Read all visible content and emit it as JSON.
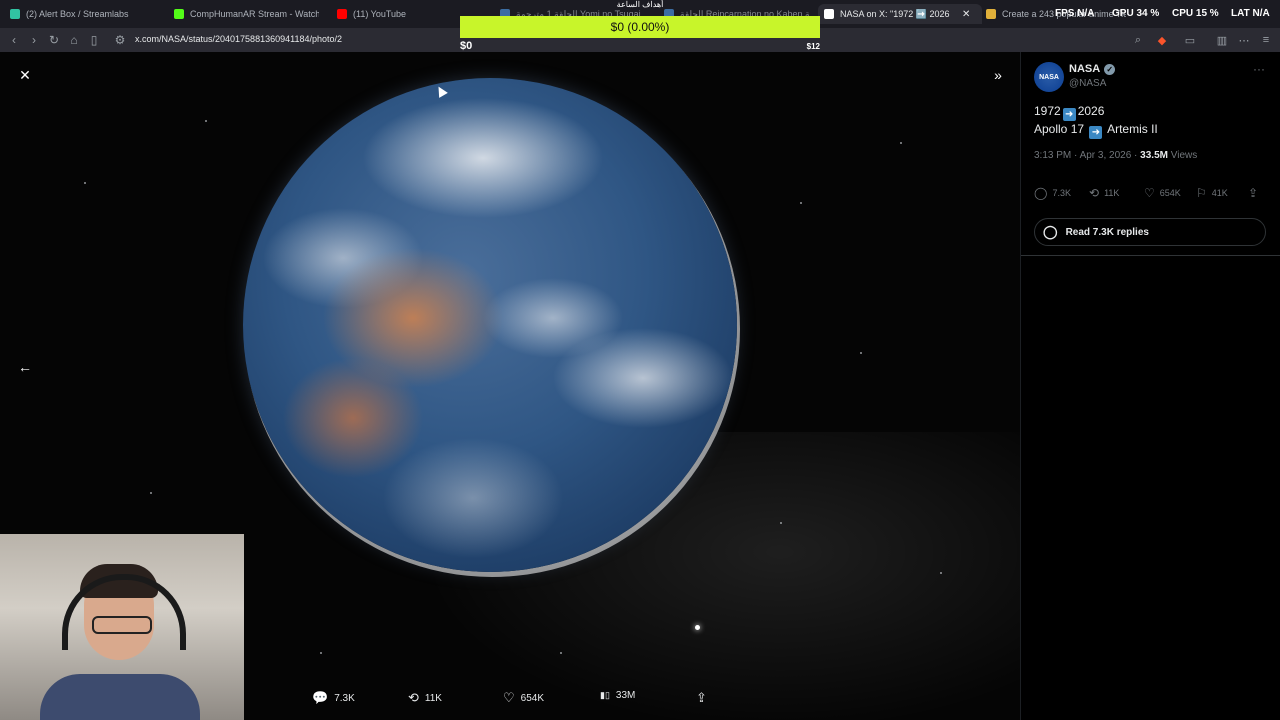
{
  "browser": {
    "tabs": [
      {
        "title": "(2) Alert Box / Streamlabs",
        "fav_color": "#31c3a2"
      },
      {
        "title": "CompHumanAR Stream - Watch Live",
        "fav_color": "#53fc18"
      },
      {
        "title": "(11) YouTube",
        "fav_color": "#ff0000"
      },
      {
        "title": "الحلقة 1 مترجمة Yomi no Tsugai",
        "fav_color": "#4a90d9"
      },
      {
        "title": "الحلقة Reincarnation no Kaben مترجمة",
        "fav_color": "#4a90d9"
      },
      {
        "title": "NASA on X: \"1972 ➡️ 2026 Apollo...",
        "fav_color": "#ffffff",
        "close": "✕"
      },
      {
        "title": "Create a 243 popular anime Tier List",
        "fav_color": "#e0b03a"
      }
    ],
    "url": "x.com/NASA/status/2040175881360941184/photo/2"
  },
  "hud": {
    "fps_label": "FPS",
    "fps_value": "N/A",
    "gpu_label": "GPU",
    "gpu_value": "34 %",
    "cpu_label": "CPU",
    "cpu_value": "15 %",
    "lat_label": "LAT",
    "lat_value": "N/A"
  },
  "goal": {
    "title": "أهداف الساعة",
    "progress_text": "$0 (0.00%)",
    "progress": 0.0,
    "min_label": "$0",
    "max_label": "$12",
    "bar_color": "#c8f52a"
  },
  "viewer": {
    "actions": [
      {
        "icon": "💬",
        "label": "7.3K"
      },
      {
        "icon": "⟲",
        "label": "11K"
      },
      {
        "icon": "♡",
        "label": "654K"
      },
      {
        "icon": "▮▯",
        "label": "33M"
      },
      {
        "icon": "⇪",
        "label": ""
      }
    ]
  },
  "tweet": {
    "display_name": "NASA",
    "handle": "@NASA",
    "avatar_text": "NASA",
    "line1_a": "1972",
    "line1_b": "2026",
    "line2_a": "Apollo 17",
    "line2_b": "Artemis II",
    "time": "3:13 PM · Apr 3, 2026 ·",
    "views_count": "33.5M",
    "views_label": "Views",
    "stats": {
      "replies": "7.3K",
      "reposts": "11K",
      "likes": "654K",
      "bookmarks": "41K"
    },
    "read_replies": "Read 7.3K replies"
  }
}
